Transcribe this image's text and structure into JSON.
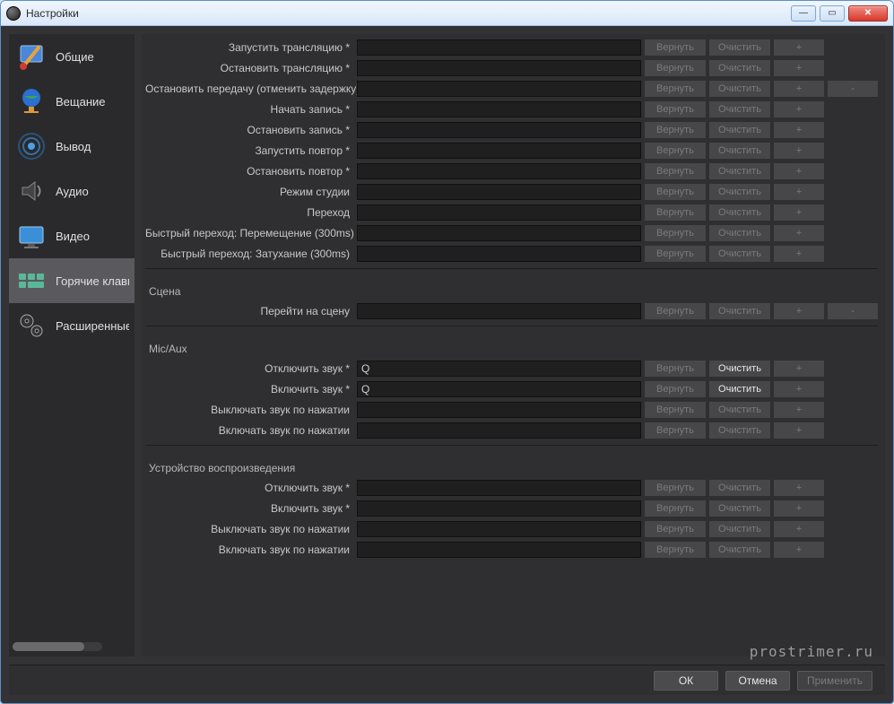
{
  "window": {
    "title": "Настройки"
  },
  "sidebar": {
    "items": [
      {
        "label": "Общие"
      },
      {
        "label": "Вещание"
      },
      {
        "label": "Вывод"
      },
      {
        "label": "Аудио"
      },
      {
        "label": "Видео"
      },
      {
        "label": "Горячие клавиши"
      },
      {
        "label": "Расширенные"
      }
    ]
  },
  "buttons": {
    "revert": "Вернуть",
    "clear": "Очистить",
    "plus": "+",
    "minus": "-"
  },
  "sections": [
    {
      "header": "",
      "rows": [
        {
          "label": "Запустить трансляцию *",
          "value": "",
          "revertEnabled": false,
          "clearEnabled": false,
          "showMinus": false
        },
        {
          "label": "Остановить трансляцию *",
          "value": "",
          "revertEnabled": false,
          "clearEnabled": false,
          "showMinus": false
        },
        {
          "label": "Остановить передачу (отменить задержку)",
          "value": "",
          "revertEnabled": false,
          "clearEnabled": false,
          "showMinus": true
        },
        {
          "label": "Начать запись *",
          "value": "",
          "revertEnabled": false,
          "clearEnabled": false,
          "showMinus": false
        },
        {
          "label": "Остановить запись *",
          "value": "",
          "revertEnabled": false,
          "clearEnabled": false,
          "showMinus": false
        },
        {
          "label": "Запустить повтор *",
          "value": "",
          "revertEnabled": false,
          "clearEnabled": false,
          "showMinus": false
        },
        {
          "label": "Остановить повтор *",
          "value": "",
          "revertEnabled": false,
          "clearEnabled": false,
          "showMinus": false
        },
        {
          "label": "Режим студии",
          "value": "",
          "revertEnabled": false,
          "clearEnabled": false,
          "showMinus": false
        },
        {
          "label": "Переход",
          "value": "",
          "revertEnabled": false,
          "clearEnabled": false,
          "showMinus": false
        },
        {
          "label": "Быстрый переход: Перемещение (300ms)",
          "value": "",
          "revertEnabled": false,
          "clearEnabled": false,
          "showMinus": false
        },
        {
          "label": "Быстрый переход: Затухание (300ms)",
          "value": "",
          "revertEnabled": false,
          "clearEnabled": false,
          "showMinus": false
        }
      ]
    },
    {
      "header": "Сцена",
      "rows": [
        {
          "label": "Перейти на сцену",
          "value": "",
          "revertEnabled": false,
          "clearEnabled": false,
          "showMinus": true
        }
      ]
    },
    {
      "header": "Mic/Aux",
      "rows": [
        {
          "label": "Отключить звук *",
          "value": "Q",
          "revertEnabled": false,
          "clearEnabled": true,
          "showMinus": false
        },
        {
          "label": "Включить звук *",
          "value": "Q",
          "revertEnabled": false,
          "clearEnabled": true,
          "showMinus": false
        },
        {
          "label": "Выключать звук по нажатии",
          "value": "",
          "revertEnabled": false,
          "clearEnabled": false,
          "showMinus": false
        },
        {
          "label": "Включать звук по нажатии",
          "value": "",
          "revertEnabled": false,
          "clearEnabled": false,
          "showMinus": false
        }
      ]
    },
    {
      "header": "Устройство воспроизведения",
      "rows": [
        {
          "label": "Отключить звук *",
          "value": "",
          "revertEnabled": false,
          "clearEnabled": false,
          "showMinus": false
        },
        {
          "label": "Включить звук *",
          "value": "",
          "revertEnabled": false,
          "clearEnabled": false,
          "showMinus": false
        },
        {
          "label": "Выключать звук по нажатии",
          "value": "",
          "revertEnabled": false,
          "clearEnabled": false,
          "showMinus": false
        },
        {
          "label": "Включать звук по нажатии",
          "value": "",
          "revertEnabled": false,
          "clearEnabled": false,
          "showMinus": false
        }
      ]
    }
  ],
  "footer": {
    "ok": "ОК",
    "cancel": "Отмена",
    "apply": "Применить"
  },
  "watermark": "prostrimer.ru"
}
